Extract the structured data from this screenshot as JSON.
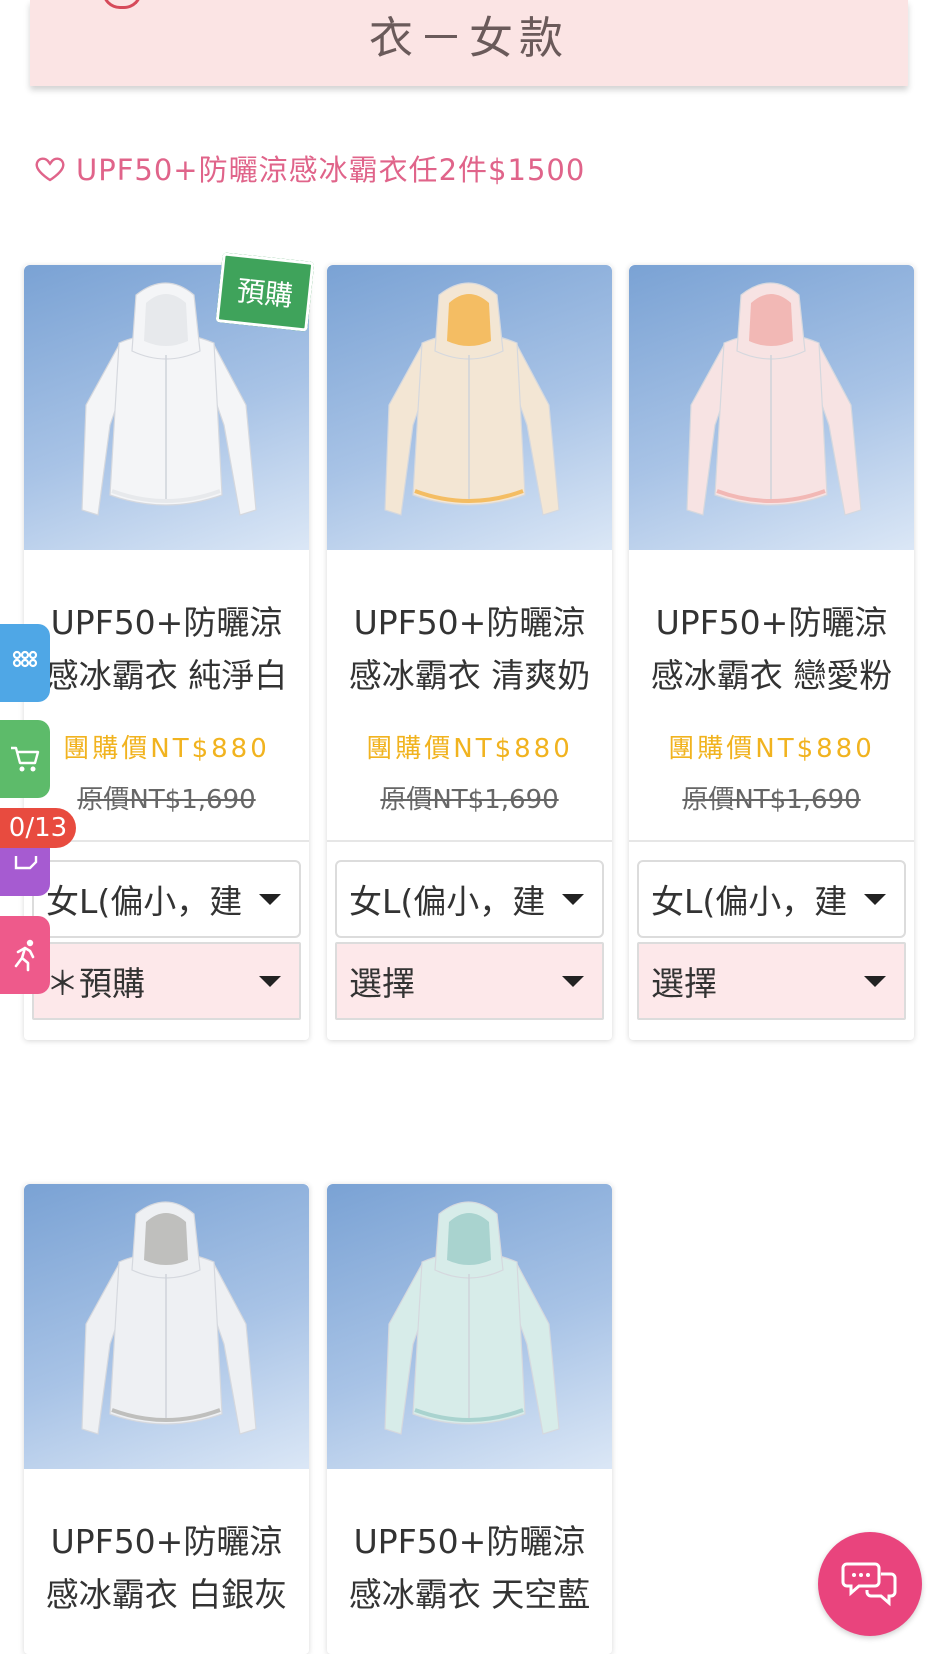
{
  "header": {
    "title": "衣－女款"
  },
  "promo": {
    "text": "UPF50+防曬涼感冰霸衣任2件$1500",
    "accent": "#e0648a"
  },
  "colors": {
    "price": "#f1b31f",
    "badge": "#3fa35b",
    "select_pink": "#fde8ea",
    "chat": "#e9447d"
  },
  "products": [
    {
      "name_line1": "UPF50+防曬涼",
      "name_line2": "感冰霸衣 純淨白",
      "price": "團購價NT$880",
      "original_price": "原價NT$1,690",
      "size_select": "女L(偏小，建",
      "option_select": "＊預購",
      "badge": "預購",
      "jacket_color": "#f4f5f7",
      "lining_color": "#e7e9ec"
    },
    {
      "name_line1": "UPF50+防曬涼",
      "name_line2": "感冰霸衣 清爽奶",
      "price": "團購價NT$880",
      "original_price": "原價NT$1,690",
      "size_select": "女L(偏小，建",
      "option_select": "選擇",
      "jacket_color": "#f3e6d4",
      "lining_color": "#f4bd63"
    },
    {
      "name_line1": "UPF50+防曬涼",
      "name_line2": "感冰霸衣 戀愛粉",
      "price": "團購價NT$880",
      "original_price": "原價NT$1,690",
      "size_select": "女L(偏小，建",
      "option_select": "選擇",
      "jacket_color": "#f7e3e3",
      "lining_color": "#f2b8b5"
    },
    {
      "name_line1": "UPF50+防曬涼",
      "name_line2": "感冰霸衣 白銀灰",
      "jacket_color": "#eef0f3",
      "lining_color": "#bfbfbd"
    },
    {
      "name_line1": "UPF50+防曬涼",
      "name_line2": "感冰霸衣 天空藍",
      "jacket_color": "#d7ece9",
      "lining_color": "#a9d3cf"
    }
  ],
  "sidebar": {
    "tabs": [
      {
        "icon": "grid-icon",
        "color": "#4fa7e6"
      },
      {
        "icon": "cart-icon",
        "color": "#5dbb6a"
      },
      {
        "icon": "note-icon",
        "color": "#a65bd1"
      },
      {
        "icon": "runner-icon",
        "color": "#ee5a8b"
      }
    ],
    "counter": "0/13"
  },
  "chat": {
    "icon": "chat-bubbles-icon"
  }
}
